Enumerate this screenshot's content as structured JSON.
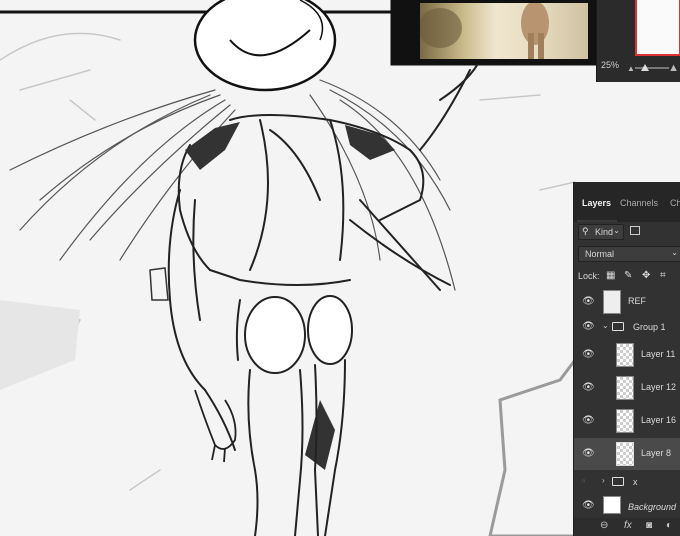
{
  "navigator": {
    "zoom": "25%"
  },
  "layers_panel": {
    "tabs": [
      {
        "label": "Layers",
        "active": true
      },
      {
        "label": "Channels",
        "active": false
      },
      {
        "label": "Ch",
        "active": false
      }
    ],
    "filter": {
      "kind_label": "Kind"
    },
    "blend_mode": "Normal",
    "lock_label": "Lock:",
    "layers": [
      {
        "name": "REF",
        "type": "image",
        "visible": true,
        "selected": false
      },
      {
        "name": "Group 1",
        "type": "group",
        "expanded": true,
        "visible": true,
        "selected": false
      },
      {
        "name": "Layer 11",
        "type": "pixel",
        "visible": true,
        "selected": false
      },
      {
        "name": "Layer 12",
        "type": "pixel",
        "visible": true,
        "selected": false
      },
      {
        "name": "Layer 16",
        "type": "pixel",
        "visible": true,
        "selected": false
      },
      {
        "name": "Layer 8",
        "type": "pixel",
        "visible": true,
        "selected": true
      },
      {
        "name": "x",
        "type": "group",
        "expanded": false,
        "visible": false,
        "selected": false
      },
      {
        "name": "Background",
        "type": "background",
        "visible": true,
        "selected": false
      }
    ],
    "bottom_icons": [
      "link-icon",
      "fx-icon",
      "mask-icon",
      "adjustment-icon"
    ]
  },
  "colors": {
    "panel_bg": "#323232",
    "tab_bar_bg": "#262626",
    "selected_row": "#4a4a4a",
    "canvas_bg": "#f4f4f4",
    "navigator_frame": "#dd3333"
  }
}
